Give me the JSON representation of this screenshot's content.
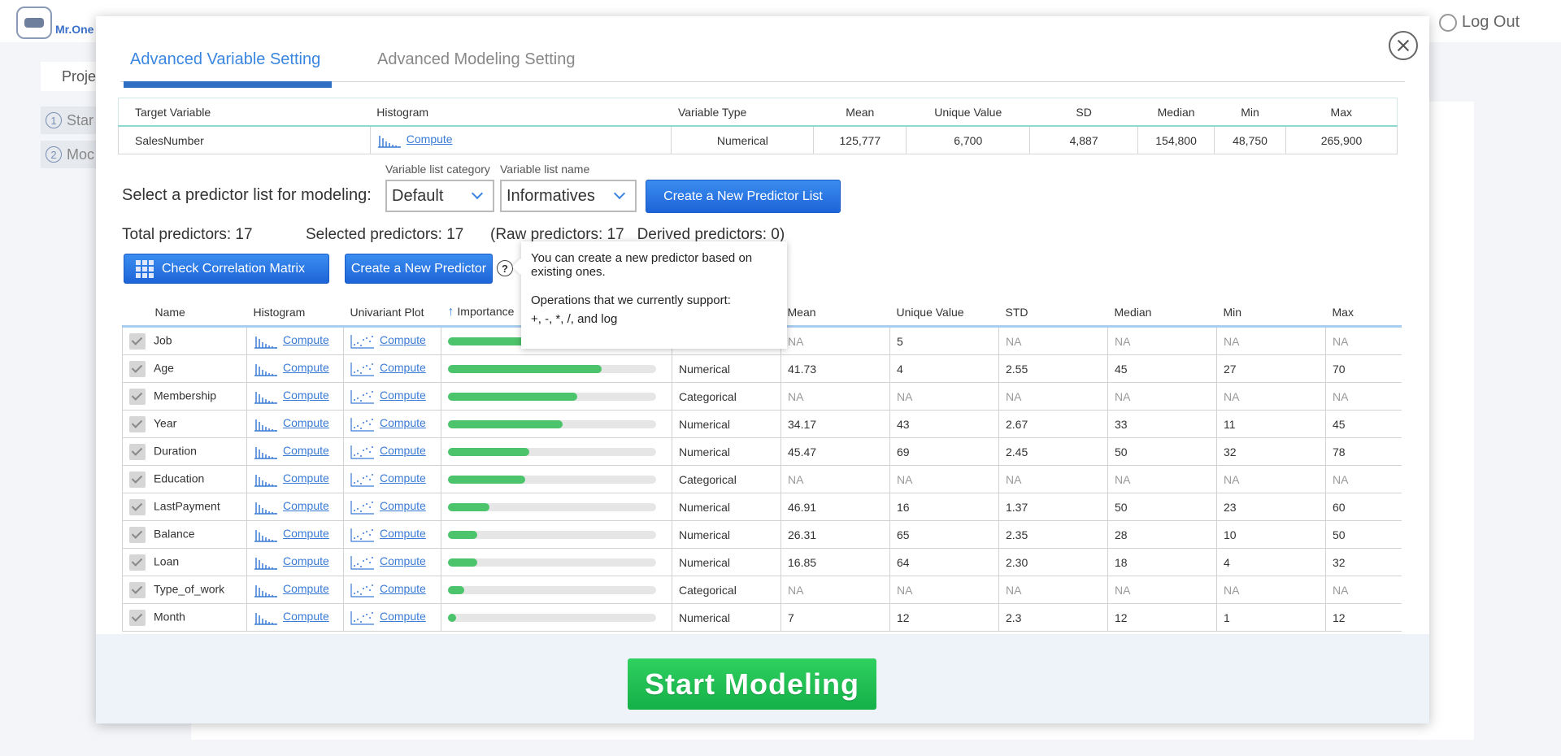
{
  "app": {
    "brand": "Mr.One",
    "logout_label": "Log Out",
    "project_tab": "Proje",
    "steps": [
      {
        "num": "1",
        "label": "Star"
      },
      {
        "num": "2",
        "label": "Moc"
      }
    ]
  },
  "modal": {
    "tabs": [
      {
        "label": "Advanced Variable Setting",
        "active": true
      },
      {
        "label": "Advanced Modeling Setting",
        "active": false
      }
    ],
    "target": {
      "headers": [
        "Target Variable",
        "Histogram",
        "Variable Type",
        "Mean",
        "Unique Value",
        "SD",
        "Median",
        "Min",
        "Max"
      ],
      "row": {
        "name": "SalesNumber",
        "histogram_link": "Compute",
        "type": "Numerical",
        "mean": "125,777",
        "unique": "6,700",
        "sd": "4,887",
        "median": "154,800",
        "min": "48,750",
        "max": "265,900"
      }
    },
    "selector": {
      "label": "Select a predictor list for modeling:",
      "category_caption": "Variable list category",
      "category_value": "Default",
      "name_caption": "Variable list name",
      "name_value": "Informatives",
      "create_list_button": "Create a New Predictor List"
    },
    "stats": {
      "total": "Total predictors: 17",
      "selected": "Selected predictors: 17",
      "raw_derived": "(Raw predictors: 17   Derived predictors: 0)"
    },
    "buttons": {
      "correlation": "Check Correlation Matrix",
      "new_predictor": "Create a New Predictor",
      "help": "?"
    },
    "tooltip": {
      "line1": "You can create a new predictor based on existing ones.",
      "line2": "Operations that we currently support:",
      "line3": "+, -, *, /, and log"
    },
    "predictors": {
      "headers": [
        "Name",
        "Histogram",
        "Univariant Plot",
        "Importance",
        "",
        "Mean",
        "Unique Value",
        "STD",
        "Median",
        "Min",
        "Max"
      ],
      "sort_indicator": "↑",
      "link_label": "Compute",
      "rows": [
        {
          "name": "Job",
          "importance": 0.4,
          "type": "",
          "mean": "NA",
          "unique": "5",
          "std": "NA",
          "median": "NA",
          "min": "NA",
          "max": "NA"
        },
        {
          "name": "Age",
          "importance": 0.74,
          "type": "Numerical",
          "mean": "41.73",
          "unique": "4",
          "std": "2.55",
          "median": "45",
          "min": "27",
          "max": "70"
        },
        {
          "name": "Membership",
          "importance": 0.62,
          "type": "Categorical",
          "mean": "NA",
          "unique": "NA",
          "std": "NA",
          "median": "NA",
          "min": "NA",
          "max": "NA"
        },
        {
          "name": "Year",
          "importance": 0.55,
          "type": "Numerical",
          "mean": "34.17",
          "unique": "43",
          "std": "2.67",
          "median": "33",
          "min": "11",
          "max": "45"
        },
        {
          "name": "Duration",
          "importance": 0.39,
          "type": "Numerical",
          "mean": "45.47",
          "unique": "69",
          "std": "2.45",
          "median": "50",
          "min": "32",
          "max": "78"
        },
        {
          "name": "Education",
          "importance": 0.37,
          "type": "Categorical",
          "mean": "NA",
          "unique": "NA",
          "std": "NA",
          "median": "NA",
          "min": "NA",
          "max": "NA"
        },
        {
          "name": "LastPayment",
          "importance": 0.2,
          "type": "Numerical",
          "mean": "46.91",
          "unique": "16",
          "std": "1.37",
          "median": "50",
          "min": "23",
          "max": "60"
        },
        {
          "name": "Balance",
          "importance": 0.14,
          "type": "Numerical",
          "mean": "26.31",
          "unique": "65",
          "std": "2.35",
          "median": "28",
          "min": "10",
          "max": "50"
        },
        {
          "name": "Loan",
          "importance": 0.14,
          "type": "Numerical",
          "mean": "16.85",
          "unique": "64",
          "std": "2.30",
          "median": "18",
          "min": "4",
          "max": "32"
        },
        {
          "name": "Type_of_work",
          "importance": 0.08,
          "type": "Categorical",
          "mean": "NA",
          "unique": "NA",
          "std": "NA",
          "median": "NA",
          "min": "NA",
          "max": "NA"
        },
        {
          "name": "Month",
          "importance": 0.04,
          "type": "Numerical",
          "mean": "7",
          "unique": "12",
          "std": "2.3",
          "median": "12",
          "min": "1",
          "max": "12"
        }
      ]
    },
    "start_button": "Start  Modeling"
  },
  "colors": {
    "accent": "#3a86e0",
    "tab_underline": "#2f6ec5",
    "bar_fill": "#4cc46b",
    "start_green": "#1ebd55"
  }
}
